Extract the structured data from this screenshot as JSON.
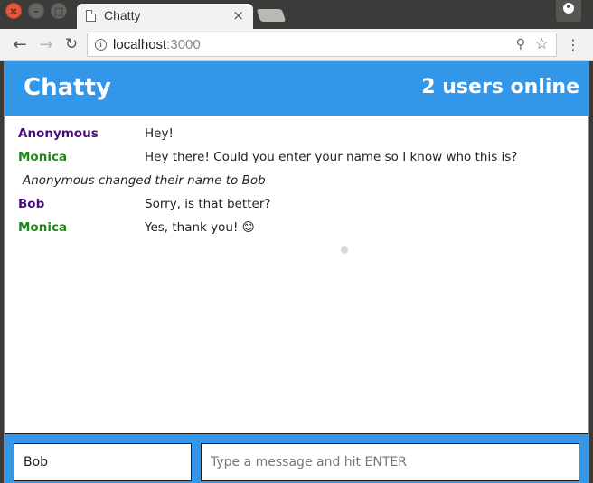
{
  "browser": {
    "tab_title": "Chatty",
    "tab_close": "×",
    "url_host": "localhost",
    "url_port": ":3000",
    "icons": [
      "close-window-icon",
      "minimize-window-icon",
      "maximize-window-icon",
      "document-icon",
      "tab-close-icon",
      "new-tab-icon",
      "profile-icon",
      "back-icon",
      "forward-icon",
      "reload-icon",
      "info-icon",
      "zoom-icon",
      "star-icon",
      "menu-icon"
    ]
  },
  "app": {
    "brand": "Chatty",
    "users_online": "2 users online",
    "accent_color": "#3296e9",
    "messages": [
      {
        "type": "message",
        "user": "Anonymous",
        "user_color": "#4b0c7e",
        "content": "Hey!"
      },
      {
        "type": "message",
        "user": "Monica",
        "user_color": "#1a8a14",
        "content": "Hey there! Could you enter your name so I know who this is?"
      },
      {
        "type": "system",
        "content": "Anonymous changed their name to Bob"
      },
      {
        "type": "message",
        "user": "Bob",
        "user_color": "#4b0c7e",
        "content": "Sorry, is that better?"
      },
      {
        "type": "message",
        "user": "Monica",
        "user_color": "#1a8a14",
        "content": "Yes, thank you! 😊"
      }
    ],
    "chatbar": {
      "username_value": "Bob",
      "message_placeholder": "Type a message and hit ENTER"
    }
  }
}
